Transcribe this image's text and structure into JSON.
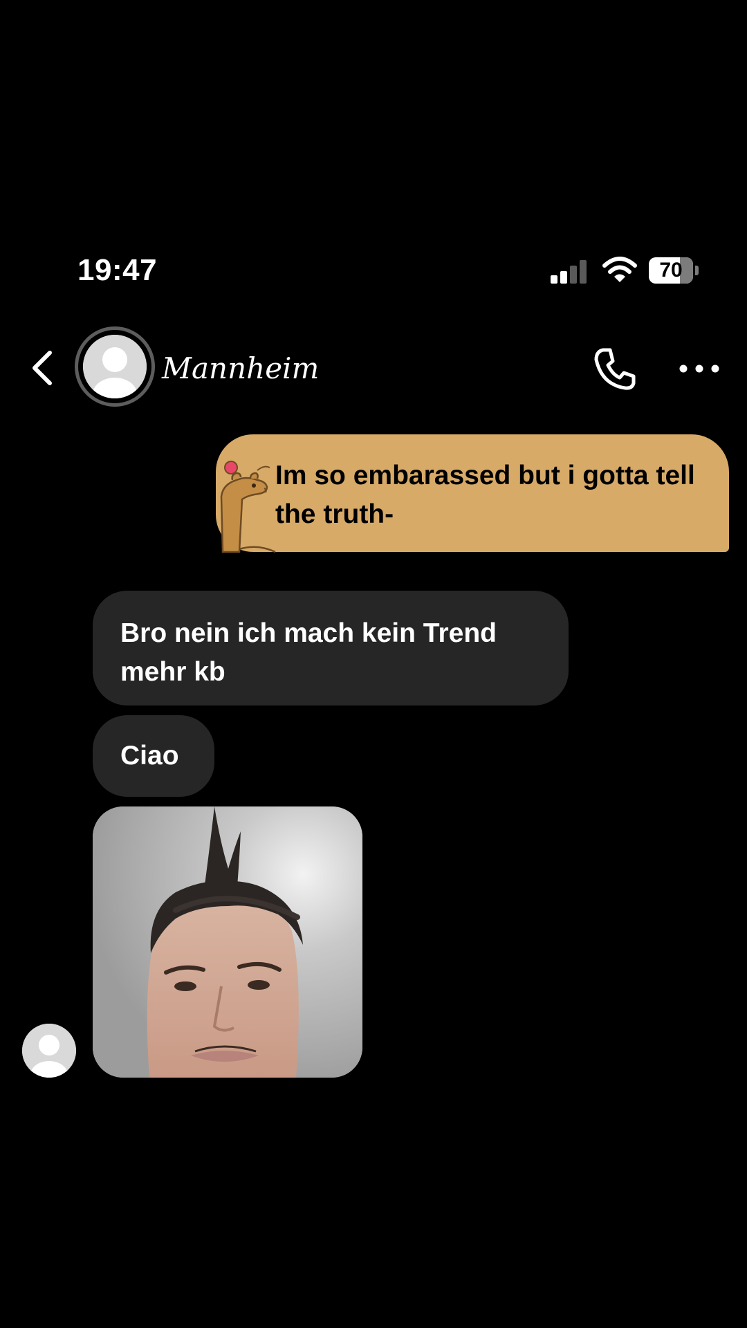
{
  "status_bar": {
    "time": "19:47",
    "battery_percent": "70",
    "battery_level": 0.7,
    "signal_bars_active": 2,
    "signal_bars_total": 4,
    "icons": [
      "signal-icon",
      "wifi-icon",
      "battery-icon"
    ]
  },
  "header": {
    "contact_name": "Mannheim",
    "icons": [
      "back-chevron-icon",
      "avatar-placeholder-icon",
      "phone-icon",
      "more-dots-icon"
    ]
  },
  "messages": [
    {
      "direction": "sent",
      "text": "Im so embarassed but i gotta tell the truth-",
      "bubble_color": "#d8aa68",
      "decoration": "capybara-sticker-icon"
    },
    {
      "direction": "received",
      "text": "Bro nein ich mach kein Trend mehr kb",
      "bubble_color": "#262626"
    },
    {
      "direction": "received",
      "text": "Ciao",
      "bubble_color": "#262626"
    },
    {
      "direction": "received",
      "type": "photo",
      "content": "selfie-photo"
    }
  ],
  "colors": {
    "background": "#000000",
    "sent_bubble": "#d8aa68",
    "received_bubble": "#262626",
    "text_primary": "#ffffff"
  }
}
